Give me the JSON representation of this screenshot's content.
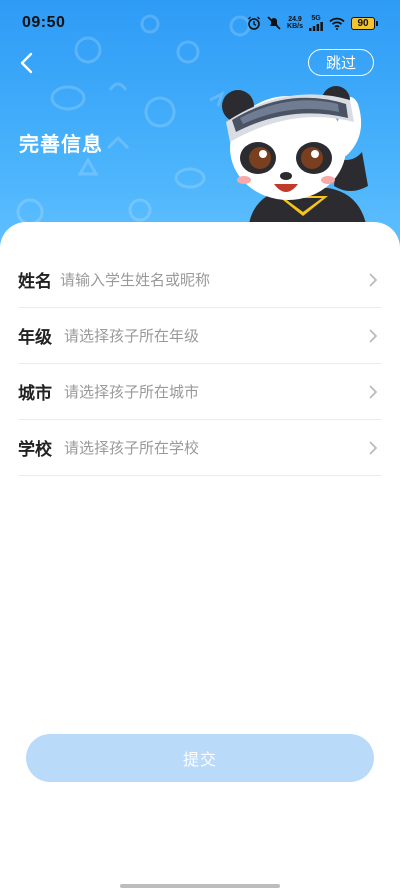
{
  "status_bar": {
    "time": "09:50",
    "speed_value": "24.9",
    "speed_unit": "KB/s",
    "network": "5G",
    "battery": "90"
  },
  "header": {
    "title": "完善信息",
    "skip_label": "跳过",
    "back_icon": "chevron-left-icon"
  },
  "form": {
    "rows": [
      {
        "label": "姓名",
        "placeholder": "请输入学生姓名或昵称"
      },
      {
        "label": "年级",
        "placeholder": "请选择孩子所在年级"
      },
      {
        "label": "城市",
        "placeholder": "请选择孩子所在城市"
      },
      {
        "label": "学校",
        "placeholder": "请选择孩子所在学校"
      }
    ]
  },
  "submit_label": "提交",
  "colors": {
    "header_blue": "#2e9bf6",
    "submit_disabled": "#b9daf9"
  }
}
